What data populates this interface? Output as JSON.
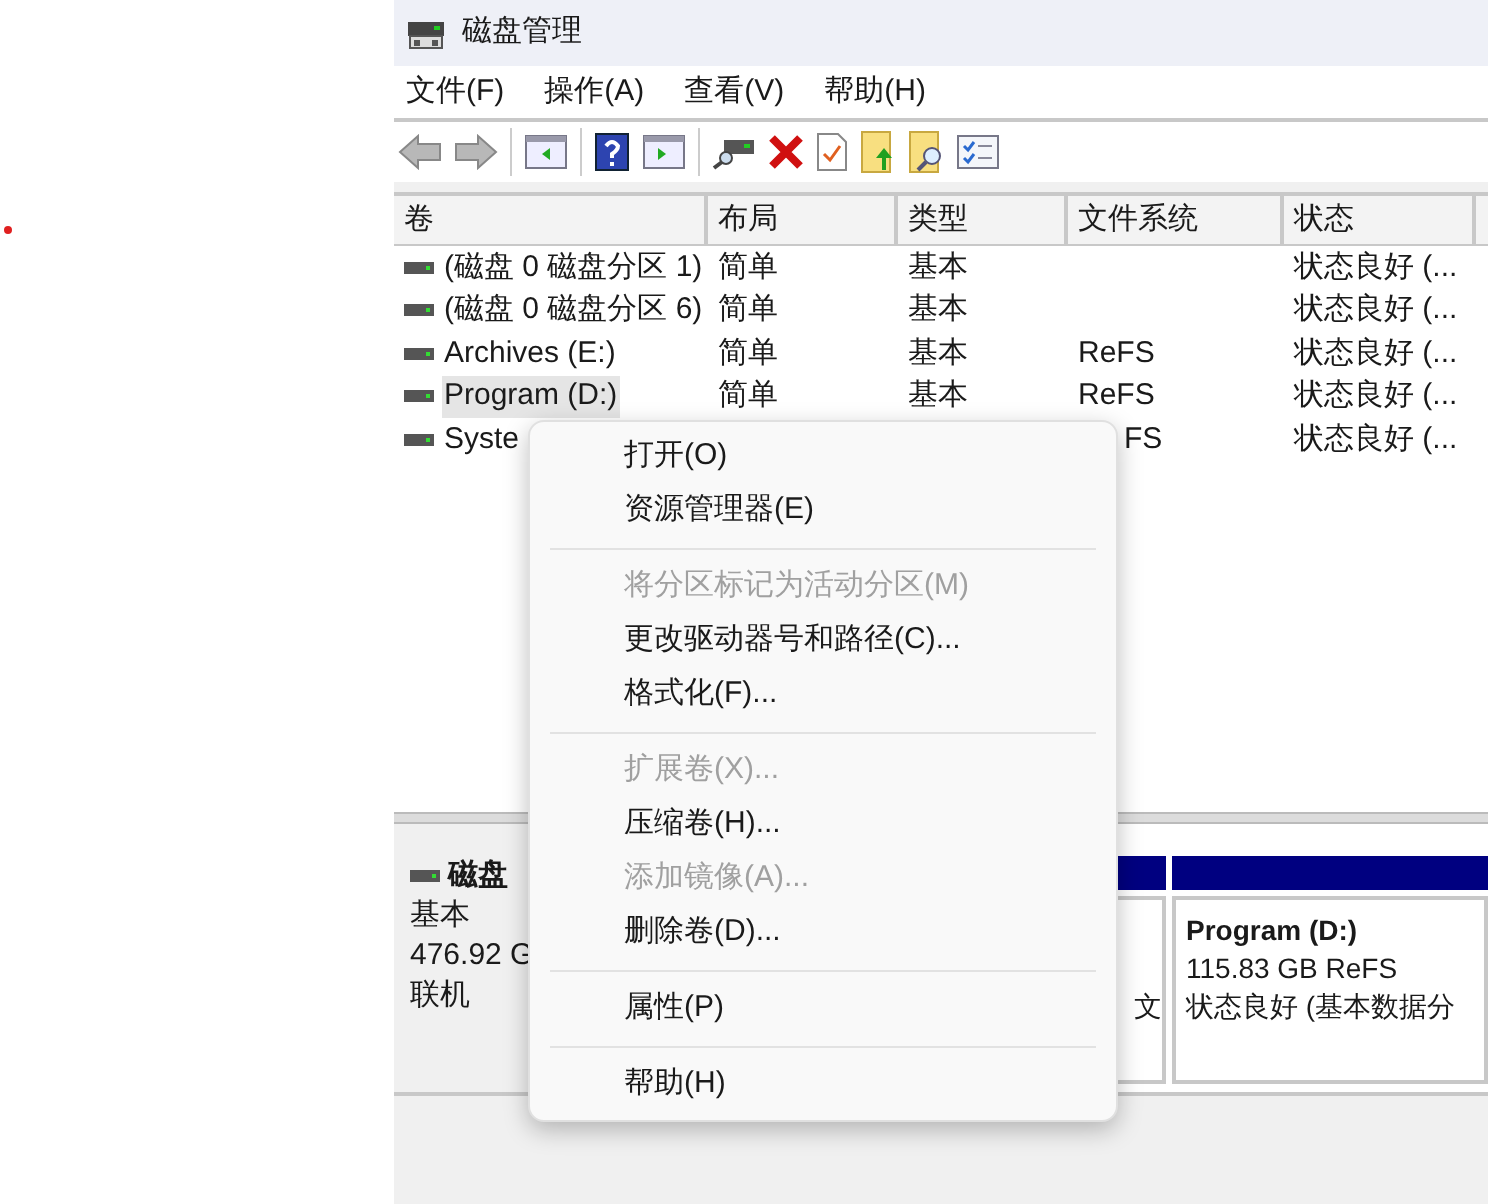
{
  "window": {
    "title": "磁盘管理"
  },
  "menu": [
    {
      "label": "文件(F)"
    },
    {
      "label": "操作(A)"
    },
    {
      "label": "查看(V)"
    },
    {
      "label": "帮助(H)"
    }
  ],
  "table": {
    "columns": [
      "卷",
      "布局",
      "类型",
      "文件系统",
      "状态"
    ],
    "rows": [
      {
        "cells": [
          "(磁盘 0 磁盘分区 1)",
          "简单",
          "基本",
          "",
          "状态良好 (..."
        ],
        "selected": false
      },
      {
        "cells": [
          "(磁盘 0 磁盘分区 6)",
          "简单",
          "基本",
          "",
          "状态良好 (..."
        ],
        "selected": false
      },
      {
        "cells": [
          "Archives (E:)",
          "简单",
          "基本",
          "ReFS",
          "状态良好 (..."
        ],
        "selected": false
      },
      {
        "cells": [
          "Program (D:)",
          "简单",
          "基本",
          "ReFS",
          "状态良好 (..."
        ],
        "selected": true
      },
      {
        "cells": [
          "Syste",
          "",
          "",
          "FS",
          "状态良好 (..."
        ],
        "selected": false
      }
    ]
  },
  "context_menu": [
    {
      "kind": "item",
      "label": "打开(O)",
      "disabled": false
    },
    {
      "kind": "item",
      "label": "资源管理器(E)",
      "disabled": false
    },
    {
      "kind": "separator"
    },
    {
      "kind": "item",
      "label": "将分区标记为活动分区(M)",
      "disabled": true
    },
    {
      "kind": "item",
      "label": "更改驱动器号和路径(C)...",
      "disabled": false
    },
    {
      "kind": "item",
      "label": "格式化(F)...",
      "disabled": false
    },
    {
      "kind": "separator"
    },
    {
      "kind": "item",
      "label": "扩展卷(X)...",
      "disabled": true
    },
    {
      "kind": "item",
      "label": "压缩卷(H)...",
      "disabled": false
    },
    {
      "kind": "item",
      "label": "添加镜像(A)...",
      "disabled": true
    },
    {
      "kind": "item",
      "label": "删除卷(D)...",
      "disabled": false
    },
    {
      "kind": "separator"
    },
    {
      "kind": "item",
      "label": "属性(P)",
      "disabled": false
    },
    {
      "kind": "separator"
    },
    {
      "kind": "item",
      "label": "帮助(H)",
      "disabled": false
    }
  ],
  "disk": {
    "name": "磁盘",
    "type": "基本",
    "size": "476.92 G",
    "status": "联机"
  },
  "partitions": [
    {
      "lines": [
        "文"
      ]
    },
    {
      "title": "Program  (D:)",
      "lines": [
        "115.83 GB ReFS",
        "状态良好 (基本数据分"
      ]
    }
  ]
}
